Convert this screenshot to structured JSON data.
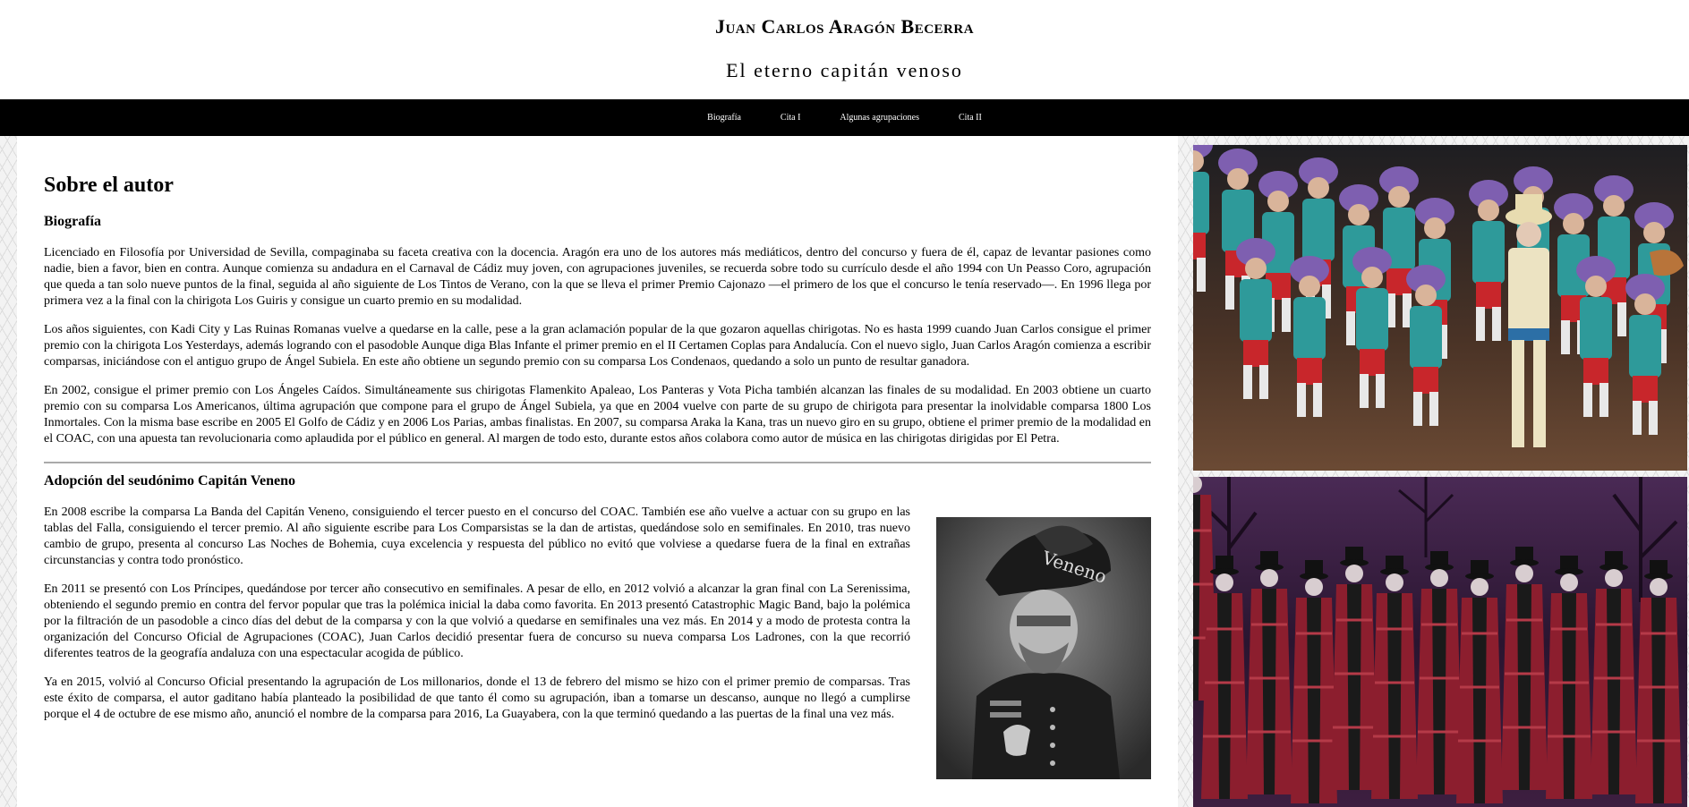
{
  "header": {
    "title": "Juan Carlos Aragón Becerra",
    "subtitle": "El eterno capitán venoso"
  },
  "nav": {
    "items": [
      {
        "label": "Biografía"
      },
      {
        "label": "Cita I"
      },
      {
        "label": "Algunas agrupaciones"
      },
      {
        "label": "Cita II"
      }
    ]
  },
  "main": {
    "section_title": "Sobre el autor",
    "bio_heading": "Biografía",
    "bio_paragraphs": [
      "Licenciado en Filosofía por Universidad de Sevilla, compaginaba su faceta creativa con la docencia. Aragón era uno de los autores más mediáticos, dentro del concurso y fuera de él, capaz de levantar pasiones como nadie, bien a favor, bien en contra. Aunque comienza su andadura en el Carnaval de Cádiz muy joven, con agrupaciones juveniles, se recuerda sobre todo su currículo desde el año 1994 con Un Peasso Coro, agrupación que queda a tan solo nueve puntos de la final, seguida al año siguiente de Los Tintos de Verano, con la que se lleva el primer Premio Cajonazo —el primero de los que el concurso le tenía reservado—. En 1996 llega por primera vez a la final con la chirigota Los Guiris y consigue un cuarto premio en su modalidad.",
      "Los años siguientes, con Kadi City y Las Ruinas Romanas vuelve a quedarse en la calle, pese a la gran aclamación popular de la que gozaron aquellas chirigotas. No es hasta 1999 cuando Juan Carlos consigue el primer premio con la chirigota Los Yesterdays, además logrando con el pasodoble Aunque diga Blas Infante el primer premio en el II Certamen Coplas para Andalucía. Con el nuevo siglo, Juan Carlos Aragón comienza a escribir comparsas, iniciándose con el antiguo grupo de Ángel Subiela. En este año obtiene un segundo premio con su comparsa Los Condenaos, quedando a solo un punto de resultar ganadora.",
      "En 2002, consigue el primer premio con Los Ángeles Caídos. Simultáneamente sus chirigotas Flamenkito Apaleao, Los Panteras y Vota Picha también alcanzan las finales de su modalidad. En 2003 obtiene un cuarto premio con su comparsa Los Americanos, última agrupación que compone para el grupo de Ángel Subiela, ya que en 2004 vuelve con parte de su grupo de chirigota para presentar la inolvidable comparsa 1800 Los Inmortales. Con la misma base escribe en 2005 El Golfo de Cádiz y en 2006 Los Parias, ambas finalistas. En 2007, su comparsa Araka la Kana, tras un nuevo giro en su grupo, obtiene el primer premio de la modalidad en el COAC, con una apuesta tan revolucionaria como aplaudida por el público en general. Al margen de todo esto, durante estos años colabora como autor de música en las chirigotas dirigidas por El Petra."
    ],
    "alias_heading": "Adopción del seudónimo Capitán Veneno",
    "alias_paragraphs": [
      "En 2008 escribe la comparsa La Banda del Capitán Veneno, consiguiendo el tercer puesto en el concurso del COAC. También ese año vuelve a actuar con su grupo en las tablas del Falla, consiguiendo el tercer premio. Al año siguiente escribe para Los Comparsistas se la dan de artistas, quedándose solo en semifinales. En 2010, tras nuevo cambio de grupo, presenta al concurso Las Noches de Bohemia, cuya excelencia y respuesta del público no evitó que volviese a quedarse fuera de la final en extrañas circunstancias y contra todo pronóstico.",
      "En 2011 se presentó con Los Príncipes, quedándose por tercer año consecutivo en semifinales. A pesar de ello, en 2012 volvió a alcanzar la gran final con La Serenissima, obteniendo el segundo premio en contra del fervor popular que tras la polémica inicial la daba como favorita. En 2013 presentó Catastrophic Magic Band, bajo la polémica por la filtración de un pasodoble a cinco días del debut de la comparsa y con la que volvió a quedarse en semifinales una vez más. En 2014 y a modo de protesta contra la organización del Concurso Oficial de Agrupaciones (COAC), Juan Carlos decidió presentar fuera de concurso su nueva comparsa Los Ladrones, con la que recorrió diferentes teatros de la geografía andaluza con una espectacular acogida de público.",
      "Ya en 2015, volvió al Concurso Oficial presentando la agrupación de Los millonarios, donde el 13 de febrero del mismo se hizo con el primer premio de comparsas. Tras este éxito de comparsa, el autor gaditano había planteado la posibilidad de que tanto él como su agrupación, iban a tomarse un descanso, aunque no llegó a cumplirse porque el 4 de octubre de ese mismo año, anunció el nombre de la comparsa para 2016, La Guayabera, con la que terminó quedando a las puertas de la final una vez más."
    ],
    "portrait_cap_text": "Veneno"
  },
  "colors": {
    "nav_background": "#000000",
    "nav_text": "#ffffff",
    "page_background": "#ffffff",
    "divider": "#aaaaaa"
  }
}
